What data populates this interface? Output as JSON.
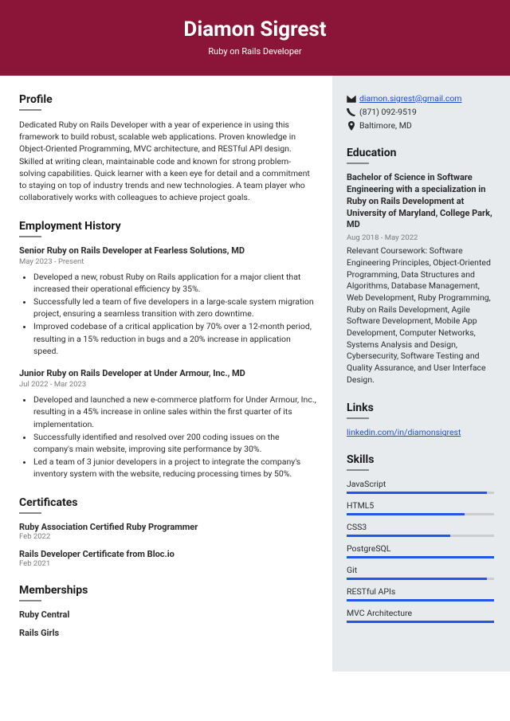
{
  "header": {
    "name": "Diamon Sigrest",
    "title": "Ruby on Rails Developer"
  },
  "profile": {
    "heading": "Profile",
    "text": "Dedicated Ruby on Rails Developer with a year of experience in using this framework to build robust, scalable web applications. Proven knowledge in Object-Oriented Programming, MVC architecture, and RESTful API design. Skilled at writing clean, maintainable code and known for strong problem-solving capabilities. Quick learner with a keen eye for detail and a commitment to staying on top of industry trends and new technologies. A team player who collaboratively works with colleagues to achieve project goals."
  },
  "employment": {
    "heading": "Employment History",
    "jobs": [
      {
        "title": "Senior Ruby on Rails Developer at Fearless Solutions, MD",
        "date": "May 2023 - Present",
        "bullets": [
          "Developed a new, robust Ruby on Rails application for a major client that increased their operational efficiency by 35%.",
          "Successfully led a team of five developers in a large-scale system migration project, ensuring a seamless transition with zero downtime.",
          "Improved codebase of a critical application by 70% over a 12-month period, resulting in a 15% reduction in bugs and a 20% increase in application speed."
        ]
      },
      {
        "title": "Junior Ruby on Rails Developer at Under Armour, Inc., MD",
        "date": "Jul 2022 - Mar 2023",
        "bullets": [
          "Developed and launched a new e-commerce platform for Under Armour, Inc., resulting in a 45% increase in online sales within the first quarter of its implementation.",
          "Successfully identified and resolved over 200 coding issues on the company's main website, improving site performance by 30%.",
          "Led a team of 3 junior developers in a project to integrate the company's inventory system with the website, reducing processing times by 50%."
        ]
      }
    ]
  },
  "certificates": {
    "heading": "Certificates",
    "items": [
      {
        "title": "Ruby Association Certified Ruby Programmer",
        "date": "Feb 2022"
      },
      {
        "title": "Rails Developer Certificate from Bloc.io",
        "date": "Feb 2021"
      }
    ]
  },
  "memberships": {
    "heading": "Memberships",
    "items": [
      "Ruby Central",
      "Rails Girls"
    ]
  },
  "contact": {
    "email": "diamon.sigrest@gmail.com",
    "phone": "(871) 092-9519",
    "location": "Baltimore, MD"
  },
  "education": {
    "heading": "Education",
    "title": "Bachelor of Science in Software Engineering with a specialization in Ruby on Rails Development at University of Maryland, College Park, MD",
    "date": "Aug 2018 - May 2022",
    "body": "Relevant Coursework: Software Engineering Principles, Object-Oriented Programming, Data Structures and Algorithms, Database Management, Web Development, Ruby Programming, Ruby on Rails Development, Agile Software Development, Mobile App Development, Computer Networks, Systems Analysis and Design, Cybersecurity, Software Testing and Quality Assurance, and User Interface Design."
  },
  "links": {
    "heading": "Links",
    "items": [
      "linkedin.com/in/diamonsigrest"
    ]
  },
  "skills": {
    "heading": "Skills",
    "items": [
      {
        "name": "JavaScript",
        "pct": 95
      },
      {
        "name": "HTML5",
        "pct": 80
      },
      {
        "name": "CSS3",
        "pct": 70
      },
      {
        "name": "PostgreSQL",
        "pct": 100
      },
      {
        "name": "Git",
        "pct": 95
      },
      {
        "name": "RESTful APIs",
        "pct": 100
      },
      {
        "name": "MVC Architecture",
        "pct": 100
      }
    ]
  }
}
